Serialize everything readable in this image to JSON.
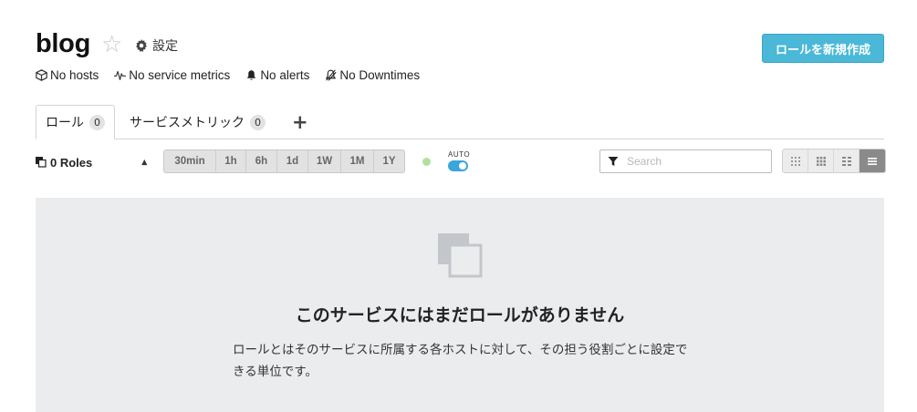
{
  "header": {
    "title": "blog",
    "settings_label": "設定",
    "create_role_label": "ロールを新規作成"
  },
  "meta": {
    "hosts": "No hosts",
    "service_metrics": "No service metrics",
    "alerts": "No alerts",
    "downtimes": "No Downtimes"
  },
  "tabs": [
    {
      "label": "ロール",
      "count": "0",
      "active": true
    },
    {
      "label": "サービスメトリック",
      "count": "0",
      "active": false
    }
  ],
  "add_tab_label": "+",
  "toolbar": {
    "roles_selector": "0 Roles",
    "time_ranges": [
      "30min",
      "1h",
      "6h",
      "1d",
      "1W",
      "1M",
      "1Y"
    ],
    "auto_label": "AUTO",
    "search_placeholder": "Search"
  },
  "empty_state": {
    "title": "このサービスにはまだロールがありません",
    "description": "ロールとはそのサービスに所属する各ホストに対して、その担う役割ごとに設定できる単位です。"
  },
  "colors": {
    "accent": "#4ab8d6",
    "toggle": "#3aa6d9",
    "live_dot": "#b3e09e",
    "empty_bg": "#ebecee"
  },
  "icons": {
    "star": "star-outline-icon",
    "settings": "gear-icon",
    "hosts": "cube-icon",
    "metrics": "pulse-icon",
    "alerts": "bell-icon",
    "downtimes": "muted-bell-icon",
    "roles": "roles-icon",
    "search": "filter-icon",
    "empty": "stacked-squares-icon"
  }
}
